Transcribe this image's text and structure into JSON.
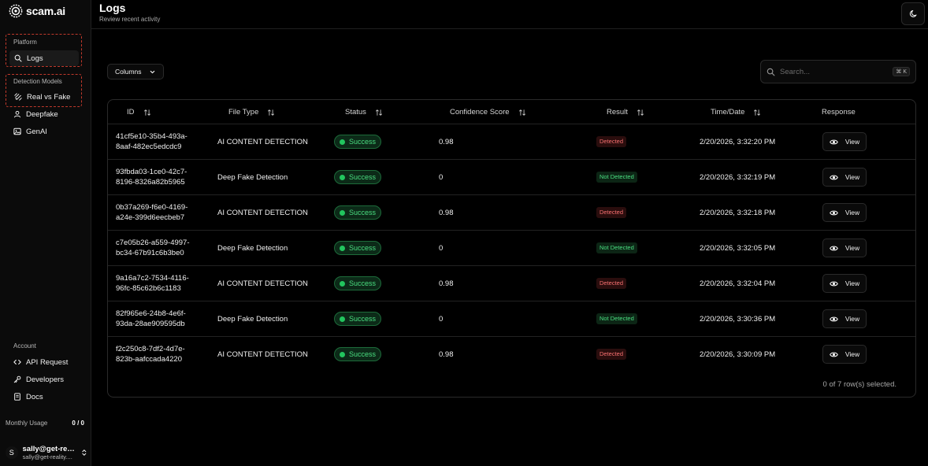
{
  "brand": {
    "name": "scam.ai"
  },
  "sidebar": {
    "platform_label": "Platform",
    "platform_items": [
      {
        "label": "Logs",
        "icon": "search-icon",
        "active": true
      }
    ],
    "models_label": "Detection Models",
    "model_items": [
      {
        "label": "Real vs Fake",
        "icon": "scan-face-icon"
      },
      {
        "label": "Deepfake",
        "icon": "user-icon"
      },
      {
        "label": "GenAI",
        "icon": "image-icon"
      }
    ],
    "account_label": "Account",
    "account_items": [
      {
        "label": "API Request",
        "icon": "code-icon"
      },
      {
        "label": "Developers",
        "icon": "key-icon"
      },
      {
        "label": "Docs",
        "icon": "book-icon"
      }
    ],
    "usage_label": "Monthly Usage",
    "usage_value": "0 / 0",
    "user": {
      "initial": "S",
      "name": "sally@get-rea...",
      "email": "sally@get-reality...."
    }
  },
  "header": {
    "title": "Logs",
    "subtitle": "Review recent activity"
  },
  "toolbar": {
    "columns_label": "Columns",
    "search_placeholder": "Search...",
    "search_shortcut": "⌘ K"
  },
  "table": {
    "headers": [
      "ID",
      "File Type",
      "Status",
      "Confidence Score",
      "Result",
      "Time/Date",
      "Response"
    ],
    "rows": [
      {
        "id_line1": "41cf5e10-35b4-493a-",
        "id_line2": "8aaf-482ec5edcdc9",
        "type": "AI CONTENT DETECTION",
        "status": "Success",
        "score": "0.98",
        "result": "Detected",
        "result_kind": "detected",
        "time": "2/20/2026, 3:32:20 PM",
        "action": "View"
      },
      {
        "id_line1": "93fbda03-1ce0-42c7-",
        "id_line2": "8196-8326a82b5965",
        "type": "Deep Fake Detection",
        "status": "Success",
        "score": "0",
        "result": "Not Detected",
        "result_kind": "notdetected",
        "time": "2/20/2026, 3:32:19 PM",
        "action": "View"
      },
      {
        "id_line1": "0b37a269-f6e0-4169-",
        "id_line2": "a24e-399d6eecbeb7",
        "type": "AI CONTENT DETECTION",
        "status": "Success",
        "score": "0.98",
        "result": "Detected",
        "result_kind": "detected",
        "time": "2/20/2026, 3:32:18 PM",
        "action": "View"
      },
      {
        "id_line1": "c7e05b26-a559-4997-",
        "id_line2": "bc34-67b91c6b3be0",
        "type": "Deep Fake Detection",
        "status": "Success",
        "score": "0",
        "result": "Not Detected",
        "result_kind": "notdetected",
        "time": "2/20/2026, 3:32:05 PM",
        "action": "View"
      },
      {
        "id_line1": "9a16a7c2-7534-4116-",
        "id_line2": "96fc-85c62b6c1183",
        "type": "AI CONTENT DETECTION",
        "status": "Success",
        "score": "0.98",
        "result": "Detected",
        "result_kind": "detected",
        "time": "2/20/2026, 3:32:04 PM",
        "action": "View"
      },
      {
        "id_line1": "82f965e6-24b8-4e6f-",
        "id_line2": "93da-28ae909595db",
        "type": "Deep Fake Detection",
        "status": "Success",
        "score": "0",
        "result": "Not Detected",
        "result_kind": "notdetected",
        "time": "2/20/2026, 3:30:36 PM",
        "action": "View"
      },
      {
        "id_line1": "f2c250c8-7df2-4d7e-",
        "id_line2": "823b-aafccada4220",
        "type": "AI CONTENT DETECTION",
        "status": "Success",
        "score": "0.98",
        "result": "Detected",
        "result_kind": "detected",
        "time": "2/20/2026, 3:30:09 PM",
        "action": "View"
      }
    ],
    "footer": "0 of 7 row(s) selected."
  },
  "colors": {
    "background": "#000000",
    "success": "#22c55e",
    "danger": "#f87171",
    "group_outline": "#c0392b"
  }
}
